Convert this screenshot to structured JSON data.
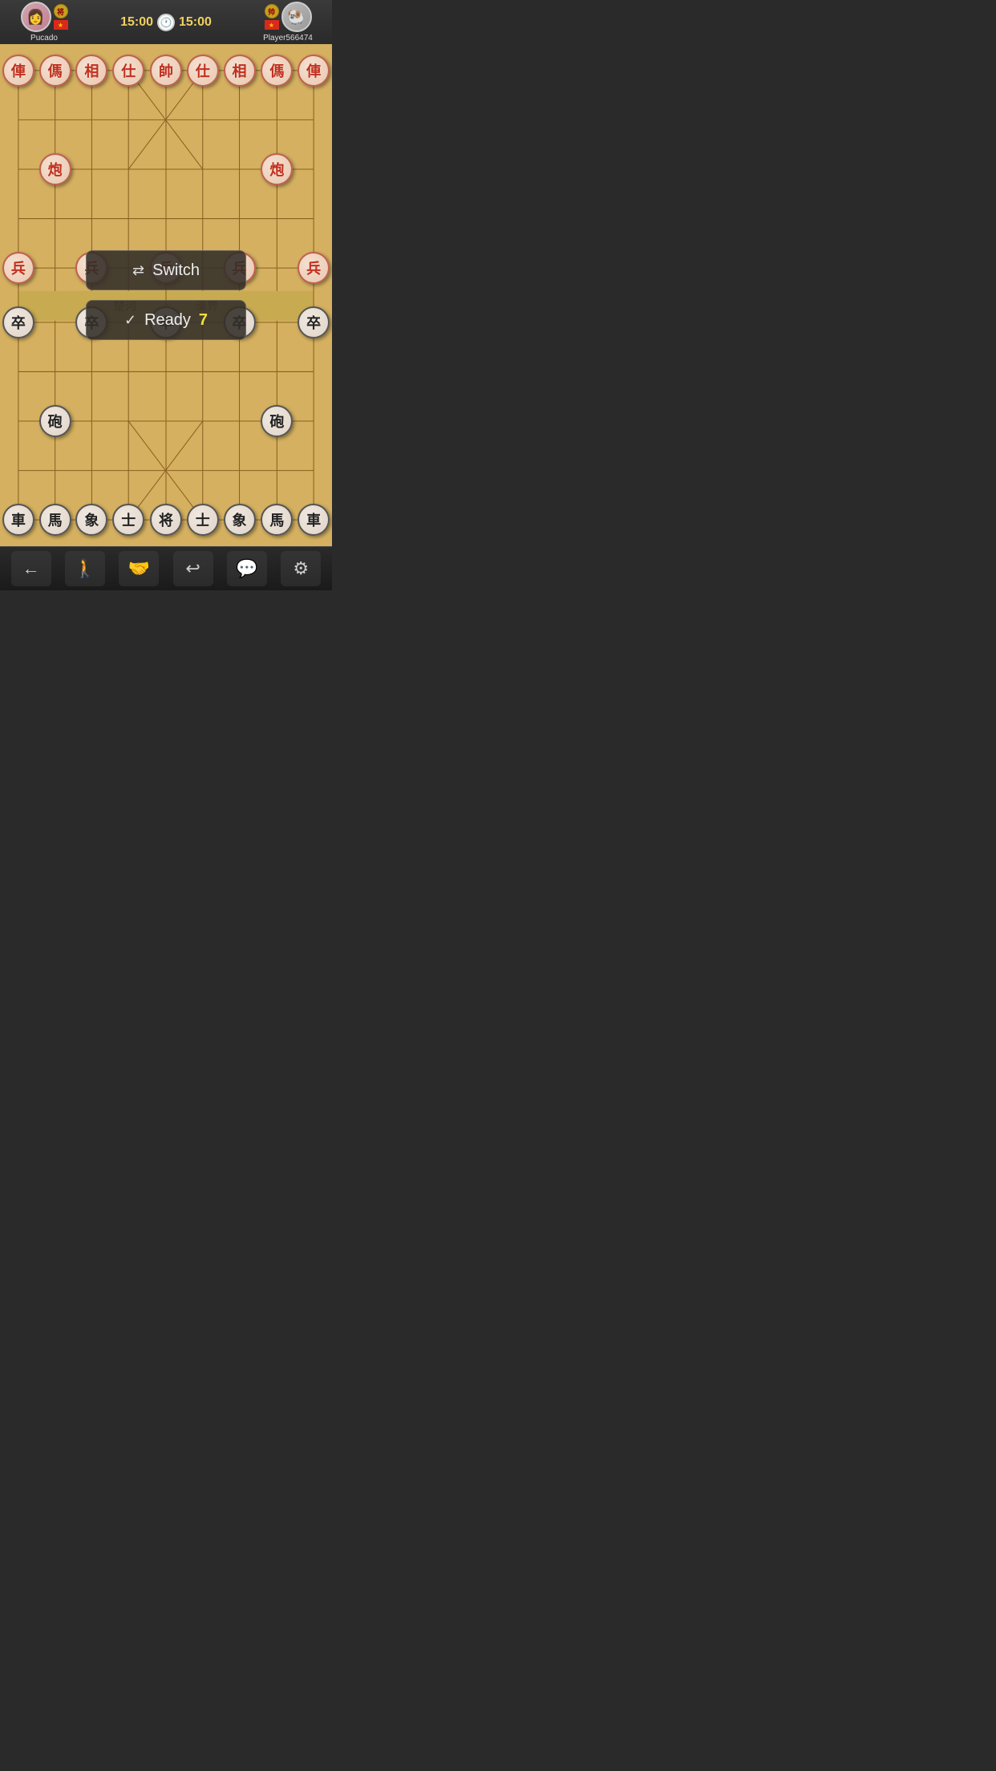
{
  "header": {
    "player_left": {
      "name": "Pucado",
      "badge": "将",
      "flag": "🇻🇳",
      "avatar_emoji": "👩"
    },
    "player_right": {
      "name": "Player566474",
      "badge": "帅",
      "flag": "🇻🇳",
      "avatar_emoji": "🐏"
    },
    "timer_left": "15:00",
    "timer_right": "15:00"
  },
  "buttons": {
    "switch_label": "Switch",
    "ready_label": "Ready",
    "ready_count": "7"
  },
  "bottom_bar": {
    "back": "←",
    "person": "🚶",
    "handshake": "🤝",
    "undo": "↩",
    "chat": "💬",
    "settings": "⚙"
  },
  "board": {
    "red_pieces": [
      {
        "char": "俥",
        "col": 0,
        "row": 0
      },
      {
        "char": "傌",
        "col": 1,
        "row": 0
      },
      {
        "char": "相",
        "col": 2,
        "row": 0
      },
      {
        "char": "仕",
        "col": 3,
        "row": 0
      },
      {
        "char": "帥",
        "col": 4,
        "row": 0
      },
      {
        "char": "仕",
        "col": 5,
        "row": 0
      },
      {
        "char": "相",
        "col": 6,
        "row": 0
      },
      {
        "char": "傌",
        "col": 7,
        "row": 0
      },
      {
        "char": "俥",
        "col": 8,
        "row": 0
      },
      {
        "char": "炮",
        "col": 1,
        "row": 2
      },
      {
        "char": "炮",
        "col": 7,
        "row": 2
      },
      {
        "char": "兵",
        "col": 0,
        "row": 4
      },
      {
        "char": "兵",
        "col": 2,
        "row": 4
      },
      {
        "char": "兵",
        "col": 4,
        "row": 4
      },
      {
        "char": "兵",
        "col": 6,
        "row": 4
      },
      {
        "char": "兵",
        "col": 8,
        "row": 4
      }
    ],
    "black_pieces": [
      {
        "char": "車",
        "col": 0,
        "row": 9
      },
      {
        "char": "馬",
        "col": 1,
        "row": 9
      },
      {
        "char": "象",
        "col": 2,
        "row": 9
      },
      {
        "char": "士",
        "col": 3,
        "row": 9
      },
      {
        "char": "将",
        "col": 4,
        "row": 9
      },
      {
        "char": "士",
        "col": 5,
        "row": 9
      },
      {
        "char": "象",
        "col": 6,
        "row": 9
      },
      {
        "char": "馬",
        "col": 7,
        "row": 9
      },
      {
        "char": "車",
        "col": 8,
        "row": 9
      },
      {
        "char": "砲",
        "col": 1,
        "row": 7
      },
      {
        "char": "砲",
        "col": 7,
        "row": 7
      },
      {
        "char": "卒",
        "col": 0,
        "row": 5
      },
      {
        "char": "卒",
        "col": 2,
        "row": 5
      },
      {
        "char": "卒",
        "col": 4,
        "row": 5
      },
      {
        "char": "卒",
        "col": 6,
        "row": 5
      },
      {
        "char": "卒",
        "col": 8,
        "row": 5
      }
    ]
  }
}
